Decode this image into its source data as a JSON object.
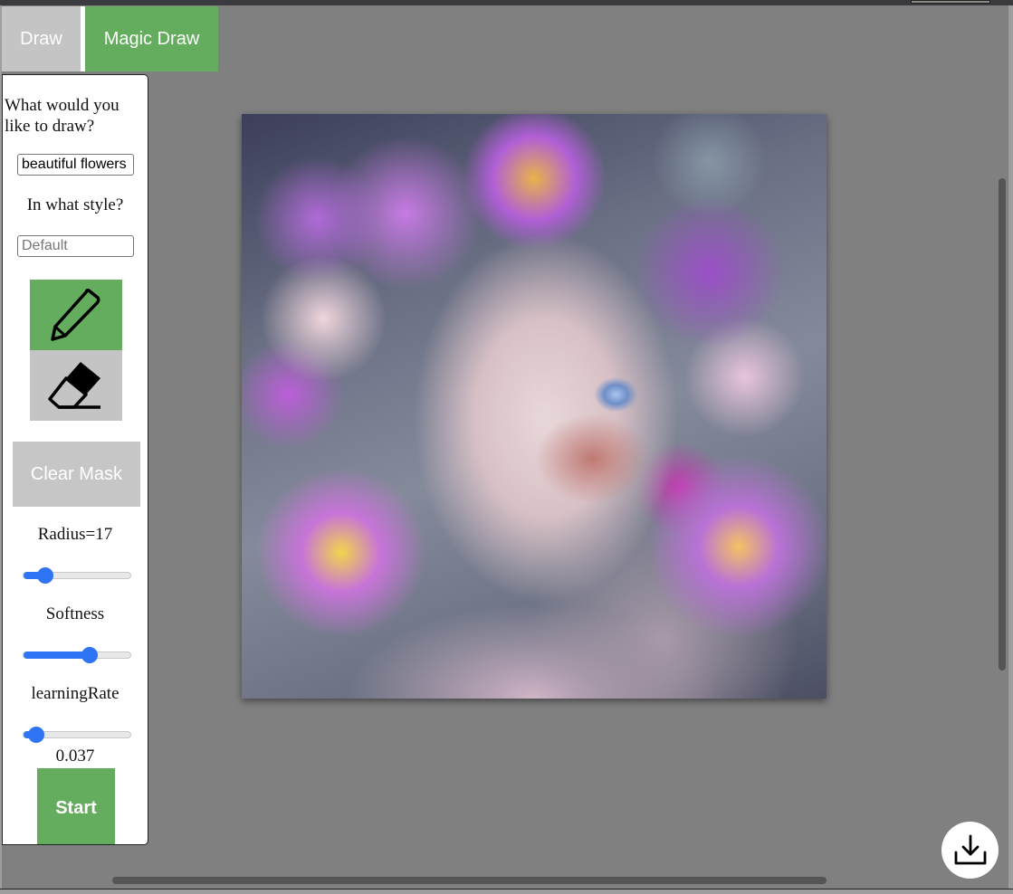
{
  "tabs": [
    {
      "label": "Draw",
      "active": false
    },
    {
      "label": "Magic Draw",
      "active": true
    }
  ],
  "panel": {
    "prompt_question": "What would you like to draw?",
    "prompt_value": "beautiful flowers",
    "style_question": "In what style?",
    "style_placeholder": "Default",
    "tools": [
      {
        "name": "pencil",
        "icon": "pencil-icon",
        "active": true
      },
      {
        "name": "eraser",
        "icon": "eraser-icon",
        "active": false
      }
    ],
    "clear_mask_label": "Clear Mask",
    "radius_label": "Radius=17",
    "radius_slider_fraction": 0.2,
    "softness_label": "Softness",
    "softness_slider_fraction": 0.62,
    "learning_rate_label": "learningRate",
    "learning_rate_slider_fraction": 0.12,
    "learning_rate_value": "0.037",
    "start_label": "Start"
  },
  "canvas": {
    "description": "Generated image: portrait of a woman surrounded by purple, pink and yellow pansy and orchid flowers"
  },
  "actions": {
    "download_icon": "download-icon"
  },
  "colors": {
    "accent_green": "#64ac5e",
    "inactive_gray": "#c4c4c4",
    "slider_blue": "#2f74f5",
    "background": "#808080"
  }
}
